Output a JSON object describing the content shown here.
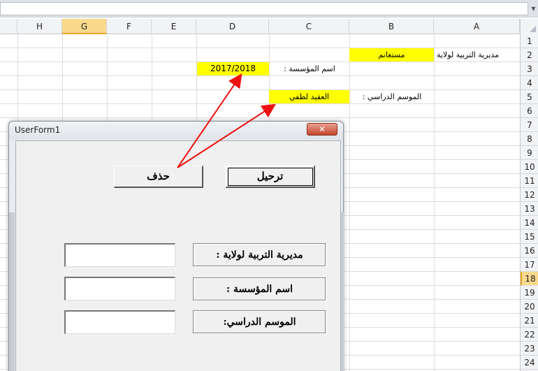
{
  "excel": {
    "columns": [
      "H",
      "G",
      "F",
      "E",
      "D",
      "C",
      "B",
      "A"
    ],
    "active_column": "G",
    "rows": [
      "1",
      "2",
      "3",
      "4",
      "5",
      "6",
      "7",
      "8",
      "9",
      "10",
      "11",
      "12",
      "13",
      "14",
      "15",
      "16",
      "17",
      "18",
      "19",
      "20",
      "21",
      "22",
      "23",
      "24"
    ],
    "active_row": "18",
    "cells": {
      "A2": "مديرية التربية لولاية",
      "B2": "مستغانم",
      "C3": "اسم المؤسسة :",
      "D3": "2017/2018",
      "B5": "الموسم الدراسي :",
      "C5": "العقيد لطفي"
    },
    "highlight_color": "#ffff00"
  },
  "userform": {
    "title": "UserForm1",
    "close_label": "✕",
    "buttons": {
      "delete": "حذف",
      "transfer": "ترحيل"
    },
    "labels": {
      "directorate": "مديرية التربية لولاية :",
      "institution": "اسم المؤسسة :",
      "season": "الموسم الدراسي:"
    },
    "inputs": {
      "directorate": "",
      "institution": "",
      "season": ""
    }
  },
  "annotation": {
    "arrow_color": "#ee1111"
  }
}
